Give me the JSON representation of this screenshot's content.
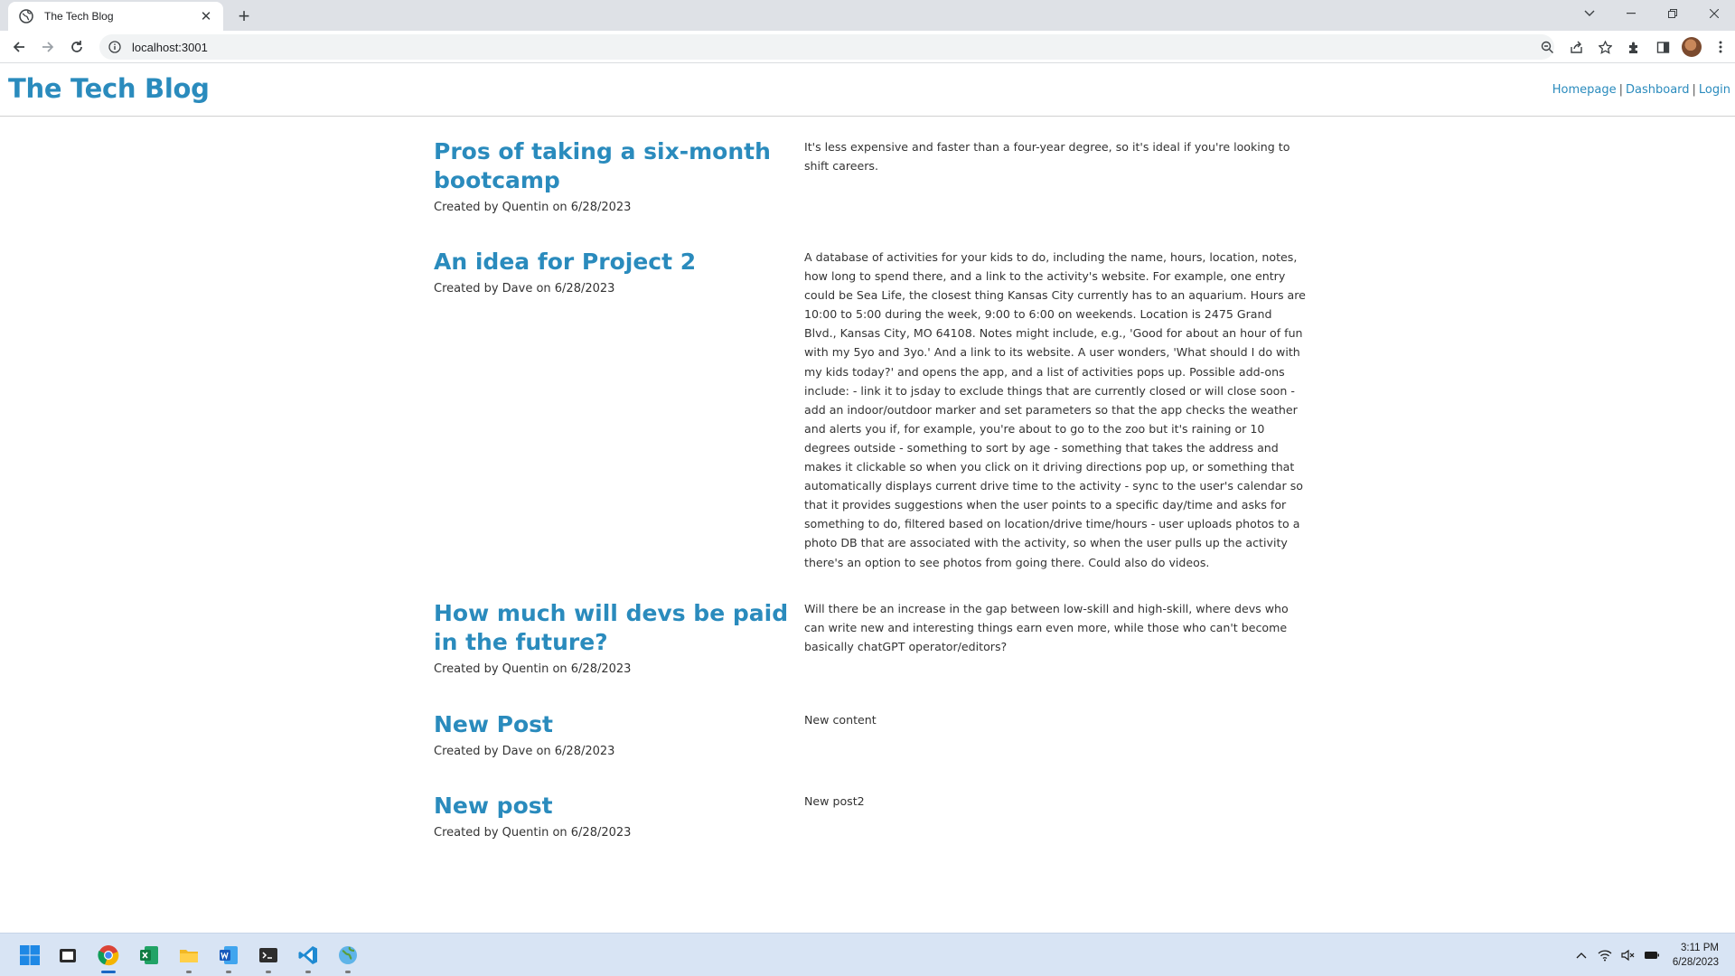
{
  "browser": {
    "tab_title": "The Tech Blog",
    "url": "localhost:3001"
  },
  "site": {
    "title": "The Tech Blog",
    "nav": [
      {
        "label": "Homepage"
      },
      {
        "label": "Dashboard"
      },
      {
        "label": "Login"
      }
    ],
    "nav_separator": "|"
  },
  "posts": [
    {
      "title": "Pros of taking a six-month bootcamp",
      "meta": "Created by Quentin on 6/28/2023",
      "content": "It's less expensive and faster than a four-year degree, so it's ideal if you're looking to shift careers."
    },
    {
      "title": "An idea for Project 2",
      "meta": "Created by Dave on 6/28/2023",
      "content": "A database of activities for your kids to do, including the name, hours, location, notes, how long to spend there, and a link to the activity's website. For example, one entry could be Sea Life, the closest thing Kansas City currently has to an aquarium. Hours are 10:00 to 5:00 during the week, 9:00 to 6:00 on weekends. Location is 2475 Grand Blvd., Kansas City, MO 64108. Notes might include, e.g., 'Good for about an hour of fun with my 5yo and 3yo.' And a link to its website. A user wonders, 'What should I do with my kids today?' and opens the app, and a list of activities pops up. Possible add-ons include: - link it to jsday to exclude things that are currently closed or will close soon - add an indoor/outdoor marker and set parameters so that the app checks the weather and alerts you if, for example, you're about to go to the zoo but it's raining or 10 degrees outside - something to sort by age - something that takes the address and makes it clickable so when you click on it driving directions pop up, or something that automatically displays current drive time to the activity - sync to the user's calendar so that it provides suggestions when the user points to a specific day/time and asks for something to do, filtered based on location/drive time/hours - user uploads photos to a photo DB that are associated with the activity, so when the user pulls up the activity there's an option to see photos from going there. Could also do videos."
    },
    {
      "title": "How much will devs be paid in the future?",
      "meta": "Created by Quentin on 6/28/2023",
      "content": "Will there be an increase in the gap between low-skill and high-skill, where devs who can write new and interesting things earn even more, while those who can't become basically chatGPT operator/editors?"
    },
    {
      "title": "New Post",
      "meta": "Created by Dave on 6/28/2023",
      "content": "New content"
    },
    {
      "title": "New post",
      "meta": "Created by Quentin on 6/28/2023",
      "content": "New post2"
    }
  ],
  "taskbar": {
    "apps": [
      "start-icon",
      "file-explorer-icon",
      "chrome-icon",
      "excel-icon",
      "folder-icon",
      "word-icon",
      "terminal-icon",
      "vscode-icon",
      "globe-icon"
    ],
    "time": "3:11 PM",
    "date": "6/28/2023"
  },
  "colors": {
    "brand": "#2a8bbd",
    "taskbar": "#d8e4f4"
  }
}
